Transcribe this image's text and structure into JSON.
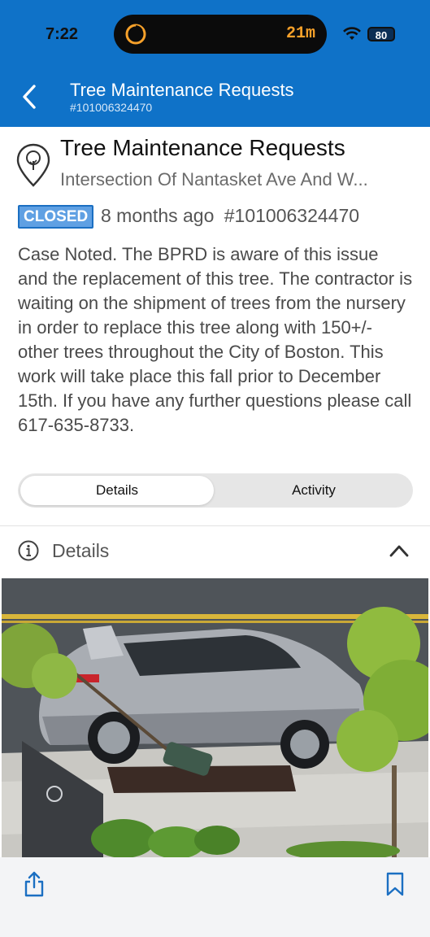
{
  "status_bar": {
    "time": "7:22",
    "timer": "21m",
    "battery": "80"
  },
  "nav": {
    "title": "Tree Maintenance Requests",
    "subtitle": "#101006324470"
  },
  "case": {
    "title": "Tree Maintenance Requests",
    "address": "Intersection Of Nantasket Ave And W...",
    "status": "CLOSED",
    "age": "8 months ago",
    "id": "#101006324470",
    "description": "Case Noted. The BPRD is aware of this issue and the replacement of this tree. The contractor is waiting on the shipment of trees from the nursery in order to replace this tree along with 150+/- other trees throughout the City of Boston. This work will take place this fall prior to December 15th. If you have any further questions please call 617-635-8733."
  },
  "tabs": [
    {
      "label": "Details",
      "active": true
    },
    {
      "label": "Activity",
      "active": false
    }
  ],
  "section": {
    "label": "Details"
  },
  "colors": {
    "header_bg": "#0f72c8",
    "badge_bg": "#5fa0e3",
    "badge_border": "#1b6fc2",
    "timer": "#f7a12a",
    "icon_blue": "#1b6fc2"
  },
  "icons": {
    "back": "chevron-left-icon",
    "case": "tree-pin-icon",
    "section": "info-icon",
    "collapse": "chevron-up-icon",
    "share": "share-icon",
    "bookmark": "bookmark-icon"
  }
}
